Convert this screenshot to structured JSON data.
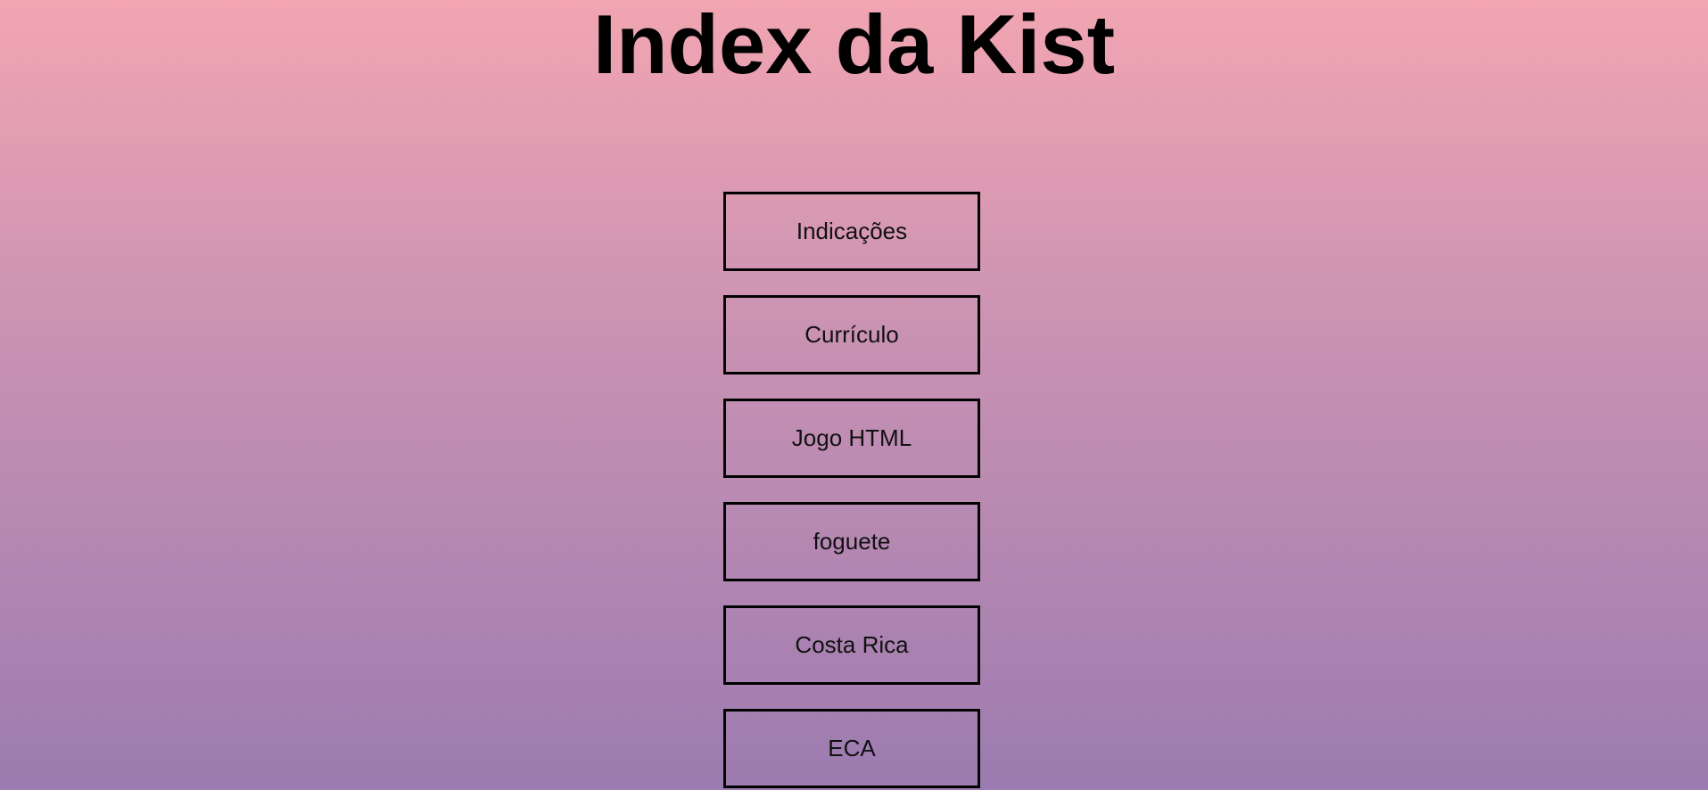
{
  "page": {
    "title": "Index da Kist"
  },
  "menu": {
    "items": [
      {
        "label": "Indicações"
      },
      {
        "label": "Currículo"
      },
      {
        "label": "Jogo HTML"
      },
      {
        "label": "foguete"
      },
      {
        "label": "Costa Rica"
      },
      {
        "label": "ECA"
      }
    ]
  },
  "colors": {
    "gradient_top": "#f2a5b1",
    "gradient_bottom": "#9c7bb0",
    "border": "#000000"
  }
}
